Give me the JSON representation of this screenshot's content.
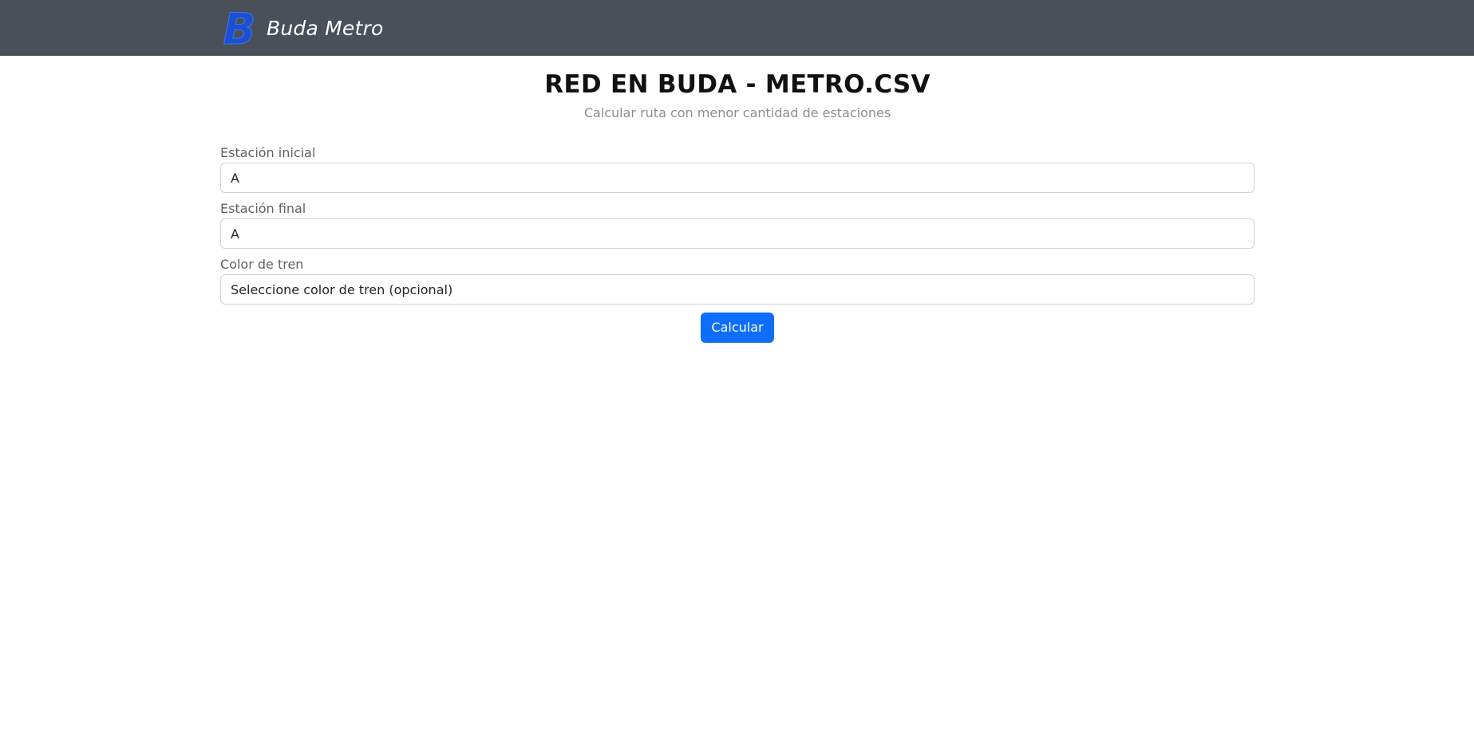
{
  "navbar": {
    "brand_name": "Buda Metro",
    "logo_letter": "B",
    "background_color": "#495057",
    "logo_color": "#1d4fd1"
  },
  "page": {
    "title": "RED EN BUDA - METRO.CSV",
    "subtitle": "Calcular ruta con menor cantidad de estaciones"
  },
  "form": {
    "start_station": {
      "label": "Estación inicial",
      "selected_value": "A"
    },
    "end_station": {
      "label": "Estación final",
      "selected_value": "A"
    },
    "train_color": {
      "label": "Color de tren",
      "selected_value": "Seleccione color de tren (opcional)"
    },
    "submit_label": "Calcular",
    "accent_color": "#0d6efd"
  }
}
